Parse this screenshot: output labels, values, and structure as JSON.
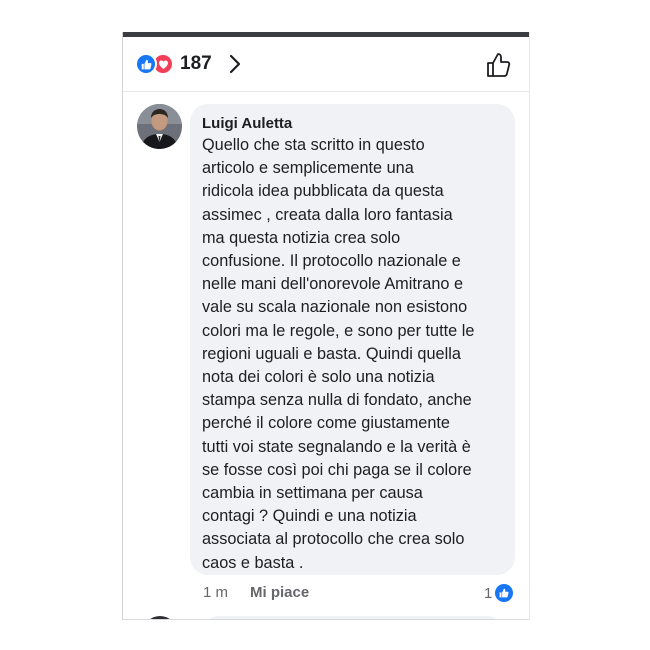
{
  "header": {
    "reaction_count": "187",
    "reaction_icons": [
      "like-icon",
      "love-icon"
    ],
    "chevron_icon": "chevron-right-icon",
    "like_button_icon": "thumbs-up-outline-icon"
  },
  "comment": {
    "author": "Luigi Auletta",
    "text": "Quello che sta scritto in questo\narticolo e semplicemente una\nridicola idea pubblicata da questa\nassimec , creata dalla loro fantasia\nma questa notizia crea solo\nconfusione. Il protocollo nazionale e\nnelle mani dell'onorevole Amitrano e\nvale su scala nazionale non esistono\ncolori ma le regole, e sono per tutte le\nregioni uguali e basta. Quindi quella\nnota dei colori è solo una notizia\nstampa senza nulla di fondato, anche\nperché il colore come giustamente\ntutti voi state segnalando e la verità è\nse fosse così poi chi paga se il colore\ncambia in settimana per causa\ncontagi ? Quindi e una notizia\nassociata al protocollo che crea solo\ncaos e basta .",
    "time": "1 m",
    "like_label": "Mi piace",
    "like_count": "1"
  },
  "colors": {
    "facebook_blue": "#1877f2",
    "love_red": "#f33e58",
    "bubble_bg": "#f0f2f5",
    "meta_gray": "#65676b",
    "text": "#1c1e21"
  }
}
